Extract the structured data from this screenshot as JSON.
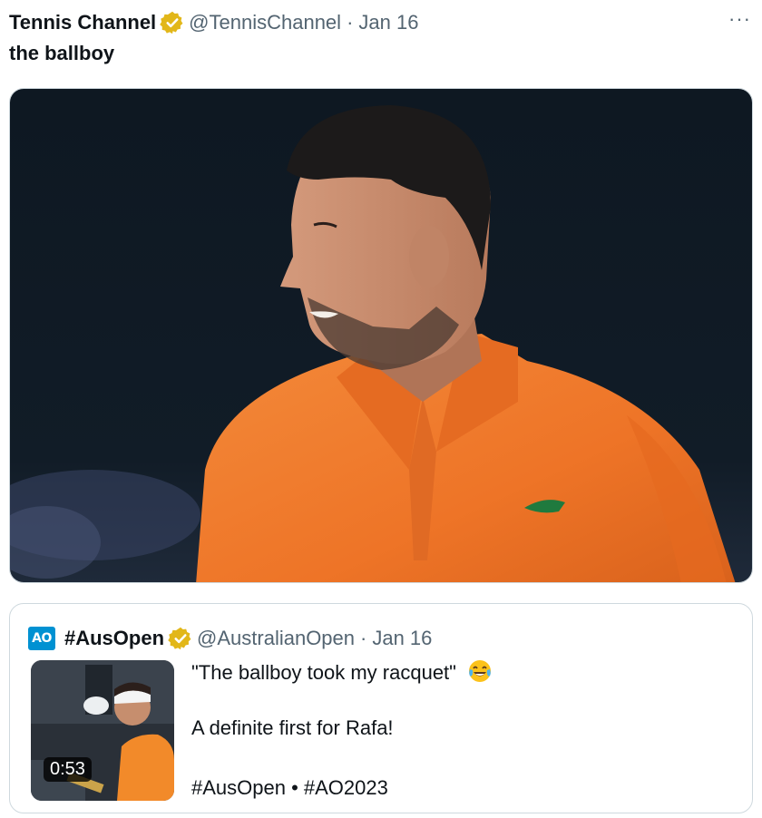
{
  "tweet": {
    "author_name": "Tennis Channel",
    "handle": "@TennisChannel",
    "separator": "·",
    "date": "Jan 16",
    "more": "···",
    "text": "the ballboy"
  },
  "quote": {
    "logo_text": "AO",
    "author_name": "#AusOpen",
    "handle": "@AustralianOpen",
    "separator": "·",
    "date": "Jan 16",
    "line1": "\"The ballboy took my racquet\"",
    "line2": "A definite first for Rafa!",
    "line3": "#AusOpen • #AO2023",
    "video_duration": "0:53"
  },
  "colors": {
    "verified_gold": "#e2b719",
    "ao_blue": "#0091d2",
    "shirt_orange": "#f07a2b",
    "background_dark": "#0d1620"
  }
}
